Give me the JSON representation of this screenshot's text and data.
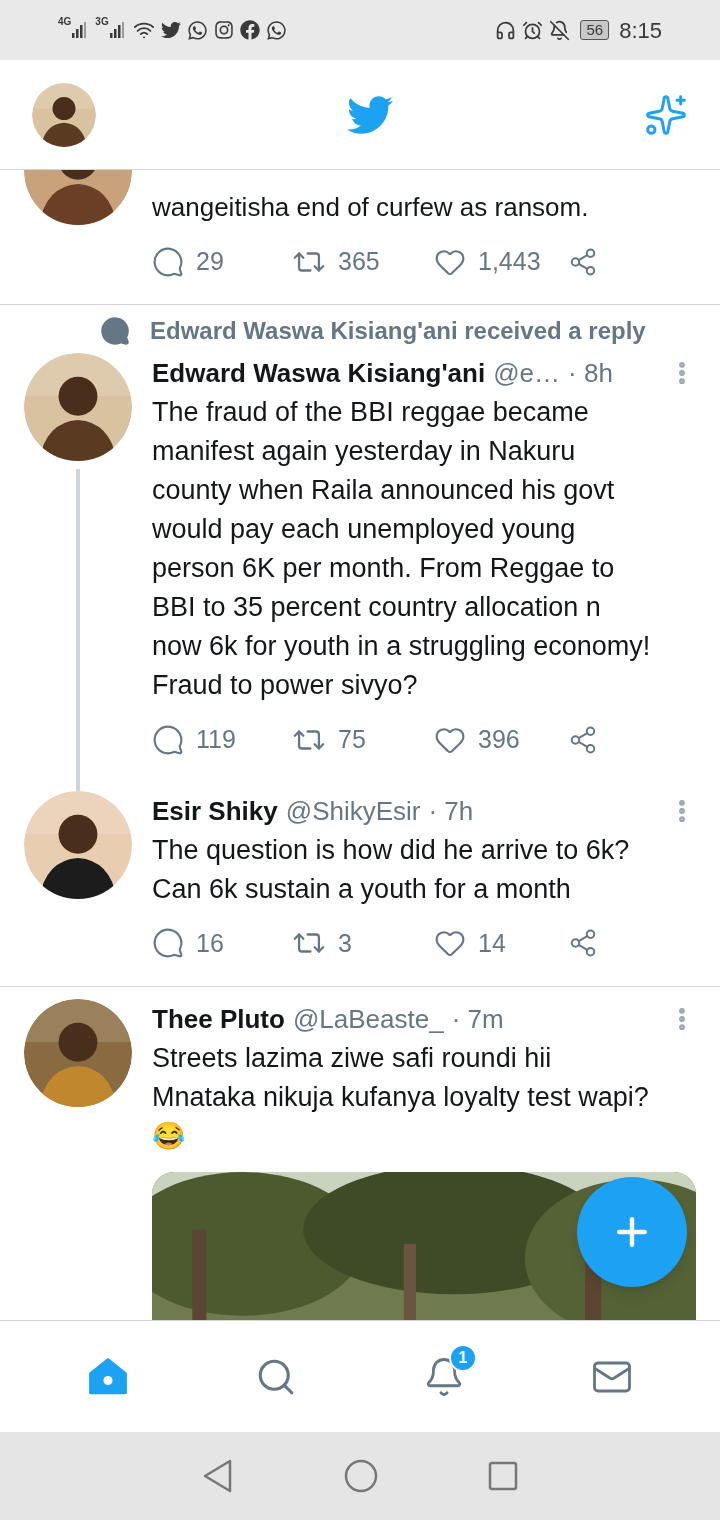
{
  "status_bar": {
    "network_1": "4G",
    "network_2": "3G",
    "battery": "56",
    "time": "8:15"
  },
  "tweets": [
    {
      "kind": "partial",
      "text": "wangeitisha end of curfew as ransom.",
      "replies": "29",
      "retweets": "365",
      "likes": "1,443"
    },
    {
      "kind": "full",
      "context": "Edward Waswa Kisiang'ani received a reply",
      "name": "Edward Waswa Kisiang'ani",
      "handle": "@e…",
      "time": "· 8h",
      "thread": true,
      "text": "The fraud of the BBI reggae became manifest again yesterday in Nakuru county when Raila announced his govt would pay each unemployed young person 6K per month. From Reggae to BBI to 35 percent country allocation n now 6k for youth in a struggling economy!  Fraud to power sivyo?",
      "replies": "119",
      "retweets": "75",
      "likes": "396"
    },
    {
      "kind": "full",
      "name": "Esir Shiky",
      "handle": "@ShikyEsir",
      "time": "· 7h",
      "thread": false,
      "text": "The question is how did he arrive to 6k? Can 6k sustain a youth for a month",
      "replies": "16",
      "retweets": "3",
      "likes": "14"
    },
    {
      "kind": "full",
      "name": "Thee Pluto",
      "handle": "@LaBeaste_",
      "time": "· 7m",
      "thread": false,
      "text": "Streets lazima ziwe safi roundi hii Mnataka nikuja kufanya loyalty test wapi?😂"
    }
  ],
  "bottom_nav": [
    {
      "kind": "home",
      "selected": true
    },
    {
      "kind": "search",
      "selected": false
    },
    {
      "kind": "notifications",
      "selected": false,
      "badge": "1"
    },
    {
      "kind": "messages",
      "selected": false
    }
  ]
}
